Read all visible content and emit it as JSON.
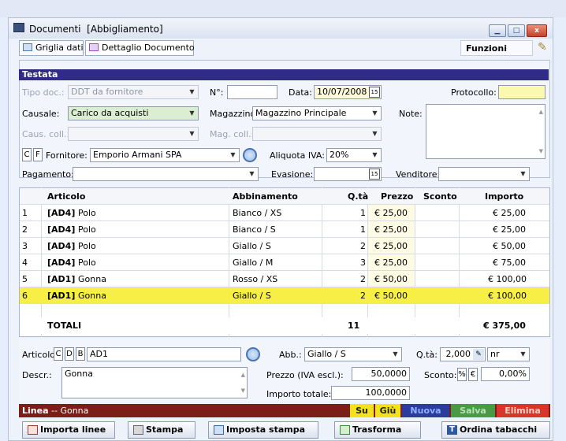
{
  "window": {
    "title": "Documenti",
    "subtitle": "[Abbigliamento]",
    "minimize": "▁",
    "maximize": "□",
    "close": "x"
  },
  "tabs": [
    {
      "label": "Griglia dati"
    },
    {
      "label": "Dettaglio Documento"
    }
  ],
  "funzioni": "Funzioni",
  "testata": {
    "section_title": "Testata",
    "tipo_doc_label": "Tipo doc.:",
    "tipo_doc": "DDT da fornitore",
    "numero_label": "N°:",
    "numero": "",
    "data_label": "Data:",
    "data": "10/07/2008",
    "protocollo_label": "Protocollo:",
    "protocollo": "",
    "causale_label": "Causale:",
    "causale": "Carico da acquisti",
    "magazzino_label": "Magazzino:",
    "magazzino": "Magazzino Principale",
    "note_label": "Note:",
    "note": "",
    "caus_coll_label": "Caus. coll.:",
    "caus_coll": "",
    "mag_coll_label": "Mag. coll.:",
    "mag_coll": "",
    "c_btn": "C",
    "f_btn": "F",
    "fornitore_label": "Fornitore:",
    "fornitore": "Emporio Armani SPA",
    "aliquota_label": "Aliquota IVA:",
    "aliquota": "20%",
    "pagamento_label": "Pagamento:",
    "pagamento": "",
    "evasione_label": "Evasione:",
    "evasione": "",
    "venditore_label": "Venditore:",
    "venditore": ""
  },
  "grid": {
    "headers": {
      "articolo": "Articolo",
      "abbinamento": "Abbinamento",
      "qta": "Q.tà",
      "prezzo": "Prezzo",
      "sconto": "Sconto",
      "importo": "Importo"
    },
    "rows": [
      {
        "n": "1",
        "code": "[AD4]",
        "name": "Polo",
        "abb": "Bianco / XS",
        "qta": "1",
        "prezzo": "€ 25,00",
        "sconto": "",
        "importo": "€ 25,00"
      },
      {
        "n": "2",
        "code": "[AD4]",
        "name": "Polo",
        "abb": "Bianco / S",
        "qta": "1",
        "prezzo": "€ 25,00",
        "sconto": "",
        "importo": "€ 25,00"
      },
      {
        "n": "3",
        "code": "[AD4]",
        "name": "Polo",
        "abb": "Giallo / S",
        "qta": "2",
        "prezzo": "€ 25,00",
        "sconto": "",
        "importo": "€ 50,00"
      },
      {
        "n": "4",
        "code": "[AD4]",
        "name": "Polo",
        "abb": "Giallo / M",
        "qta": "3",
        "prezzo": "€ 25,00",
        "sconto": "",
        "importo": "€ 75,00"
      },
      {
        "n": "5",
        "code": "[AD1]",
        "name": "Gonna",
        "abb": "Rosso / XS",
        "qta": "2",
        "prezzo": "€ 50,00",
        "sconto": "",
        "importo": "€ 100,00"
      },
      {
        "n": "6",
        "code": "[AD1]",
        "name": "Gonna",
        "abb": "Giallo / S",
        "qta": "2",
        "prezzo": "€ 50,00",
        "sconto": "",
        "importo": "€ 100,00"
      }
    ],
    "totals": {
      "label": "TOTALI",
      "qta": "11",
      "importo": "€ 375,00"
    }
  },
  "riga": {
    "articolo_label": "Articolo:",
    "c_btn": "C",
    "d_btn": "D",
    "b_btn": "B",
    "articolo": "AD1",
    "abb_label": "Abb.:",
    "abb": "Giallo / S",
    "qta_label": "Q.tà:",
    "qta": "2,000",
    "um": "nr",
    "descr_label": "Descr.:",
    "descr": "Gonna",
    "prezzo_label": "Prezzo (IVA escl.):",
    "prezzo": "50,0000",
    "sconto_label": "Sconto:",
    "sconto_pct": "%",
    "sconto_eur": "€",
    "sconto": "0,00%",
    "importo_label": "Importo totale:",
    "importo": "100,0000"
  },
  "statusbar": {
    "linea": "Linea",
    "sep": "--",
    "desc": "Gonna",
    "su": "Su",
    "giu": "Giù",
    "nuova": "Nuova",
    "salva": "Salva",
    "elimina": "Elimina"
  },
  "buttons": {
    "importa": "Importa linee",
    "stampa": "Stampa",
    "imposta": "Imposta stampa",
    "trasforma": "Trasforma",
    "ordina": "Ordina tabacchi"
  },
  "colors": {
    "header_blue": "#2f2b86",
    "selected_row": "#f7ef45",
    "status_red": "#7b1d19",
    "su_yellow": "#f2e11c",
    "nuova_blue": "#2b3c9d",
    "salva_green": "#4a9a45",
    "elimina_red": "#d8362b"
  }
}
